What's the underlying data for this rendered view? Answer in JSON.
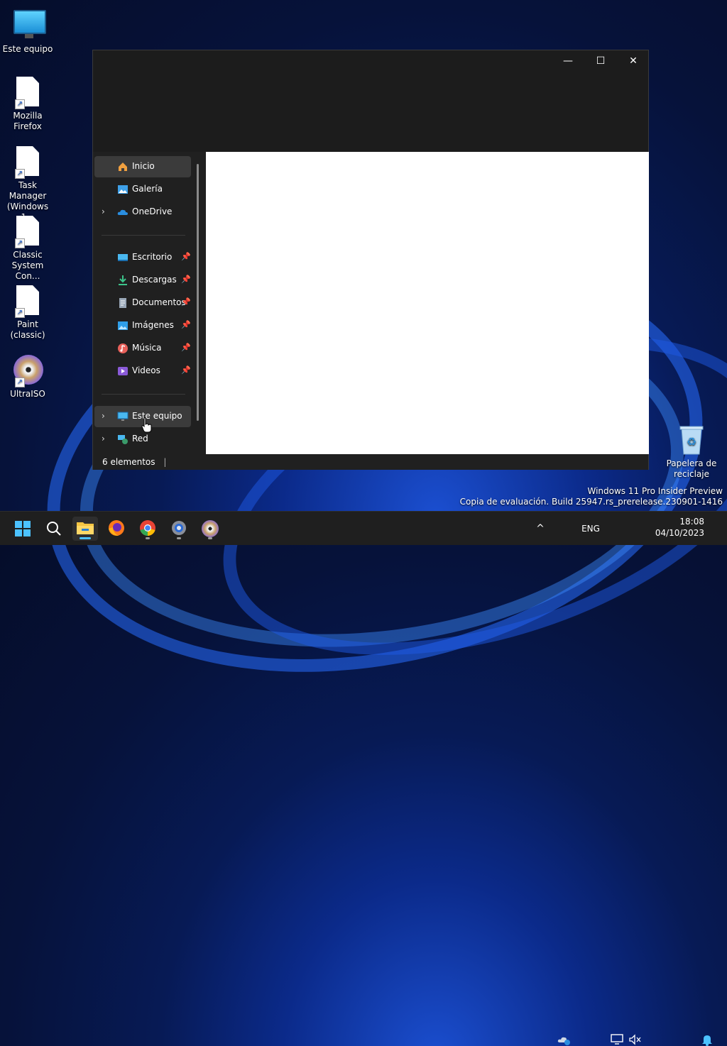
{
  "desktop": {
    "icons": [
      {
        "label": "Este equipo",
        "icon": "monitor-icon"
      },
      {
        "label": "Mozilla Firefox",
        "icon": "shortcut-file-icon"
      },
      {
        "label": "Task Manager (Windows 1...",
        "icon": "shortcut-file-icon"
      },
      {
        "label": "Classic System Con...",
        "icon": "shortcut-file-icon"
      },
      {
        "label": "Paint (classic)",
        "icon": "shortcut-file-icon"
      },
      {
        "label": "UltraISO",
        "icon": "disc-icon"
      },
      {
        "label": "Papelera de reciclaje",
        "icon": "recycle-bin-icon"
      }
    ],
    "watermark_line1": "Windows 11 Pro Insider Preview",
    "watermark_line2": "Copia de evaluación. Build 25947.rs_prerelease.230901-1416"
  },
  "window": {
    "controls": {
      "minimize": "—",
      "maximize": "☐",
      "close": "✕"
    },
    "nav": {
      "items": [
        {
          "label": "Inicio",
          "icon": "home-icon",
          "selected": true
        },
        {
          "label": "Galería",
          "icon": "gallery-icon"
        },
        {
          "label": "OneDrive",
          "icon": "cloud-icon",
          "expandable": true
        },
        {
          "label": "Escritorio",
          "icon": "desktop-folder-icon",
          "pinned": true
        },
        {
          "label": "Descargas",
          "icon": "download-icon",
          "pinned": true
        },
        {
          "label": "Documentos",
          "icon": "document-icon",
          "pinned": true
        },
        {
          "label": "Imágenes",
          "icon": "pictures-icon",
          "pinned": true
        },
        {
          "label": "Música",
          "icon": "music-icon",
          "pinned": true
        },
        {
          "label": "Videos",
          "icon": "video-icon",
          "pinned": true
        },
        {
          "label": "Este equipo",
          "icon": "this-pc-icon",
          "expandable": true,
          "hovered": true
        },
        {
          "label": "Red",
          "icon": "network-icon",
          "expandable": true
        }
      ]
    },
    "status": {
      "count_text": "6 elementos"
    }
  },
  "taskbar": {
    "apps": [
      "start-icon",
      "search-icon",
      "file-explorer-icon",
      "firefox-icon",
      "chrome-icon",
      "settings-icon",
      "ultraiso-icon"
    ],
    "tray": {
      "chevron": "^",
      "language": "ENG",
      "time": "18:08",
      "date": "04/10/2023"
    }
  },
  "colors": {
    "accent": "#4cc2ff",
    "window_bg": "#202020",
    "selection": "#3b3b3b"
  }
}
